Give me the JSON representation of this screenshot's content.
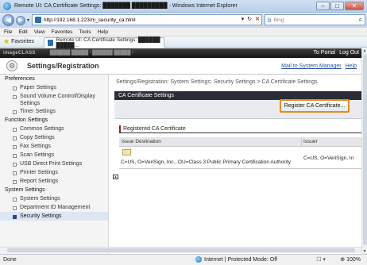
{
  "window": {
    "title": "Remote UI: CA Certificate Settings: ███████ █████████ - Windows Internet Explorer",
    "controls": {
      "minimize": "–",
      "maximize": "□",
      "close": "✕"
    }
  },
  "address_bar": {
    "url": "http://192.168.1.223/m_security_ca.html",
    "search_placeholder": "Bing"
  },
  "menu": [
    "File",
    "Edit",
    "View",
    "Favorites",
    "Tools",
    "Help"
  ],
  "favorites_bar": {
    "favorites_label": "Favorites",
    "tab_title": "Remote UI: CA Certificate Settings: ██████ █████..."
  },
  "brand_bar": {
    "logo": "imageCLASS",
    "model": "██████ █████ / ██████ █████ /",
    "to_portal": "To Portal",
    "log_out": "Log Out"
  },
  "header": {
    "title": "Settings/Registration",
    "mail_link": "Mail to System Manager",
    "help_link": "Help"
  },
  "sidebar": {
    "preferences": {
      "label": "Preferences",
      "items": [
        "Paper Settings",
        "Sound Volume Control/Display Settings",
        "Timer Settings"
      ]
    },
    "function_settings": {
      "label": "Function Settings",
      "items": [
        "Common Settings",
        "Copy Settings",
        "Fax Settings",
        "Scan Settings",
        "USB Direct Print Settings",
        "Printer Settings",
        "Report Settings"
      ]
    },
    "system_settings": {
      "label": "System Settings",
      "items": [
        "System Settings",
        "Department ID Management",
        "Security Settings"
      ]
    }
  },
  "main": {
    "breadcrumb": "Settings/Registration: System Settings: Security Settings > CA Certificate Settings",
    "panel_title": "CA Certificate Settings",
    "register_button": "Register CA Certificate...",
    "list_title": "Registered CA Certificate",
    "columns": [
      "Issue Destination",
      "Issuer"
    ],
    "rows": [
      {
        "destination": "C=US, O=VeriSign, Inc., OU=Class 3 Public Primary Certification Authority",
        "issuer": "C=US, O=VeriSign, In"
      }
    ]
  },
  "status_bar": {
    "status": "Done",
    "zone": "Internet | Protected Mode: Off",
    "zoom": "⊕ 100%",
    "security": "☐ ▾"
  }
}
